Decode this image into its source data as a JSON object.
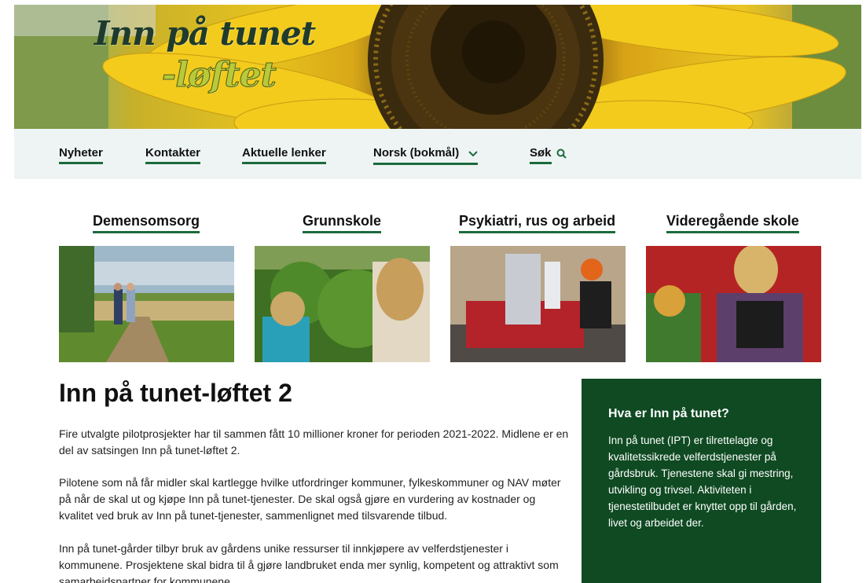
{
  "hero": {
    "logo_line1": "Inn på tunet",
    "logo_line2": "-løftet"
  },
  "nav": {
    "items": [
      {
        "label": "Nyheter"
      },
      {
        "label": "Kontakter"
      },
      {
        "label": "Aktuelle lenker"
      },
      {
        "label": "Norsk (bokmål)"
      },
      {
        "label": "Søk"
      }
    ]
  },
  "categories": [
    {
      "title": "Demensomsorg"
    },
    {
      "title": "Grunnskole"
    },
    {
      "title": "Psykiatri, rus og arbeid"
    },
    {
      "title": "Videregående skole"
    }
  ],
  "article": {
    "title": "Inn på tunet-løftet 2",
    "paragraphs": [
      "Fire utvalgte pilotprosjekter har til sammen fått 10 millioner kroner for perioden 2021-2022. Midlene er en del av satsingen Inn på tunet-løftet 2.",
      "Pilotene som nå får midler skal kartlegge hvilke utfordringer kommuner, fylkeskommuner og NAV møter på når de skal ut og kjøpe Inn på tunet-tjenester. De skal også gjøre en vurdering av kostnader og kvalitet ved bruk av Inn på tunet-tjenester, sammenlignet med tilsvarende tilbud.",
      "Inn på tunet-gårder tilbyr bruk av gårdens unike ressurser til innkjøpere av velferdstjenester i kommunene. Prosjektene skal bidra til å gjøre landbruket enda mer synlig, kompetent og attraktivt som samarbeidspartner for kommunene."
    ]
  },
  "infobox": {
    "title": "Hva er Inn på tunet?",
    "text": "Inn på tunet (IPT) er tilrettelagte og kvalitetssikrede velferdstjenester på gårdsbruk. Tjenestene skal gi mestring, utvikling og trivsel. Aktiviteten i tjenestetilbudet er knyttet opp til gården, livet og arbeidet der."
  },
  "colors": {
    "accent_green": "#1b6a3c",
    "nav_background": "#eef4f4",
    "infobox_background": "#0f4a22"
  },
  "icons": {
    "language_dropdown": "chevron-down-icon",
    "search": "search-icon"
  }
}
